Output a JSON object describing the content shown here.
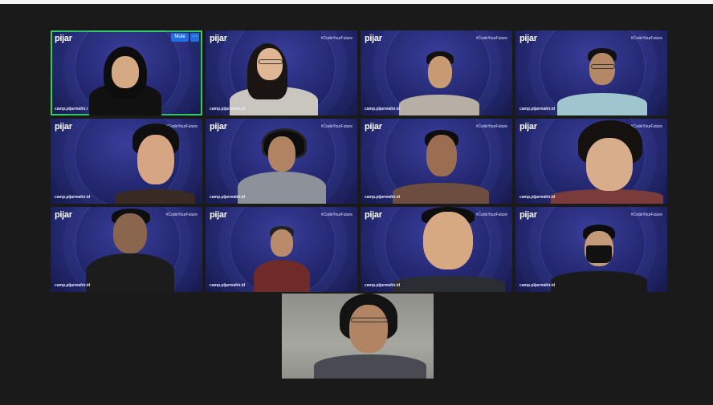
{
  "meeting": {
    "brand_logo": "pijar",
    "hashtag": "#CodeYourFuture",
    "url_text": "camp.pijarmahir.id",
    "url_text_truncated": "camp.pijarmahir.i",
    "controls": {
      "mute_label": "Mute",
      "more_label": "···"
    },
    "tiles_with_background": 12,
    "active_tile_color": "#2ed162",
    "accent_button_color": "#1f6fe0"
  }
}
